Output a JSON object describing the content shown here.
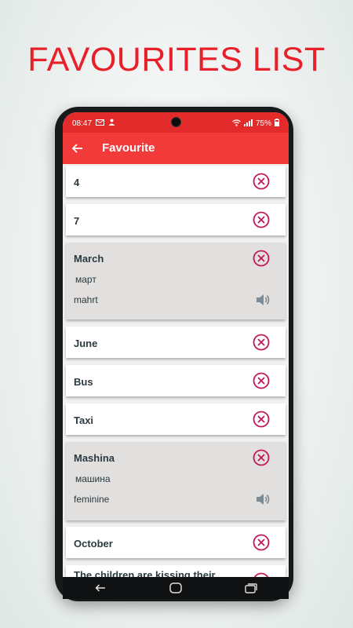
{
  "promo": {
    "title": "FAVOURITES LIST"
  },
  "status": {
    "time": "08:47",
    "battery": "75%"
  },
  "appbar": {
    "title": "Favourite"
  },
  "items": [
    {
      "word": "4"
    },
    {
      "word": "7"
    },
    {
      "word": "March",
      "translation": "март",
      "pronunciation": "mahrt"
    },
    {
      "word": "June"
    },
    {
      "word": "Bus"
    },
    {
      "word": "Taxi"
    },
    {
      "word": "Mashina",
      "translation": "машина",
      "pronunciation": "feminine"
    },
    {
      "word": "October"
    },
    {
      "word": "The children are kissing their"
    }
  ],
  "colors": {
    "accent": "#f33a3a",
    "status_bar": "#e32b2b",
    "remove_icon": "#c2185b",
    "expanded_card": "#e2dfdf"
  }
}
